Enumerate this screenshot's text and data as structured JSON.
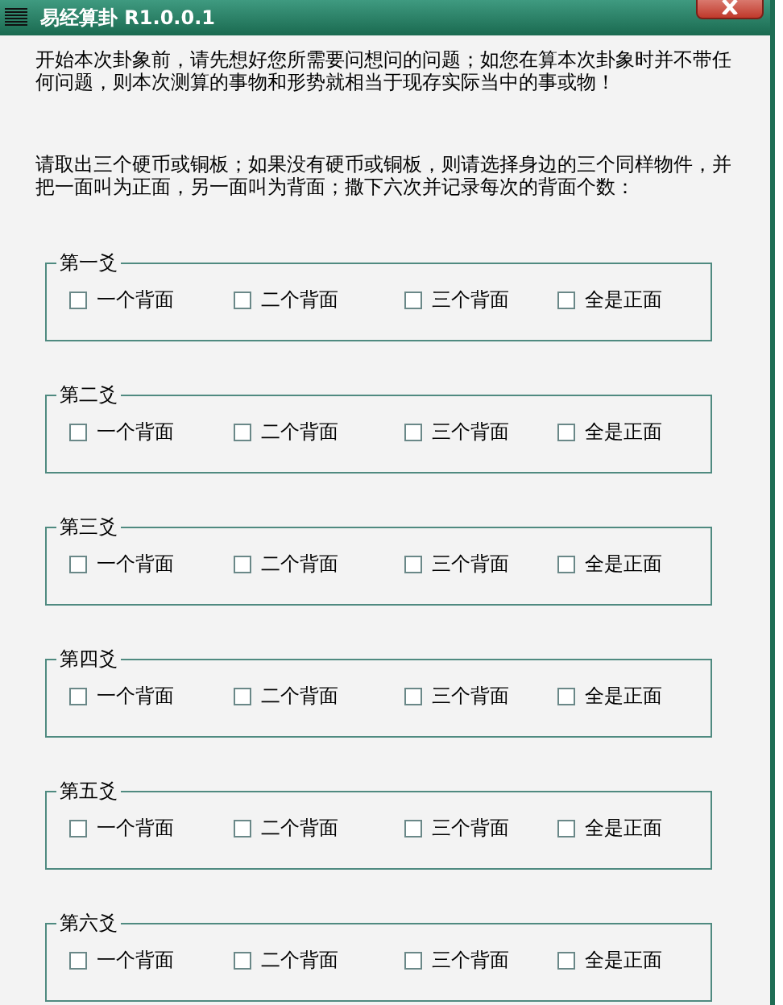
{
  "window": {
    "title": "易经算卦 R1.0.0.1"
  },
  "intro": [
    "开始本次卦象前，请先想好您所需要问想问的问题；如您在算本次卦象时并不带任何问题，则本次测算的事物和形势就相当于现存实际当中的事或物！",
    "请取出三个硬币或铜板；如果没有硬币或铜板，则请选择身边的三个同样物件，并把一面叫为正面，另一面叫为背面；撒下六次并记录每次的背面个数："
  ],
  "groups": [
    {
      "title": "第一爻",
      "options": [
        {
          "label": "一个背面",
          "checked": false
        },
        {
          "label": "二个背面",
          "checked": false
        },
        {
          "label": "三个背面",
          "checked": false
        },
        {
          "label": "全是正面",
          "checked": false
        }
      ]
    },
    {
      "title": "第二爻",
      "options": [
        {
          "label": "一个背面",
          "checked": false
        },
        {
          "label": "二个背面",
          "checked": false
        },
        {
          "label": "三个背面",
          "checked": false
        },
        {
          "label": "全是正面",
          "checked": false
        }
      ]
    },
    {
      "title": "第三爻",
      "options": [
        {
          "label": "一个背面",
          "checked": false
        },
        {
          "label": "二个背面",
          "checked": false
        },
        {
          "label": "三个背面",
          "checked": false
        },
        {
          "label": "全是正面",
          "checked": false
        }
      ]
    },
    {
      "title": "第四爻",
      "options": [
        {
          "label": "一个背面",
          "checked": false
        },
        {
          "label": "二个背面",
          "checked": false
        },
        {
          "label": "三个背面",
          "checked": false
        },
        {
          "label": "全是正面",
          "checked": false
        }
      ]
    },
    {
      "title": "第五爻",
      "options": [
        {
          "label": "一个背面",
          "checked": false
        },
        {
          "label": "二个背面",
          "checked": false
        },
        {
          "label": "三个背面",
          "checked": false
        },
        {
          "label": "全是正面",
          "checked": false
        }
      ]
    },
    {
      "title": "第六爻",
      "options": [
        {
          "label": "一个背面",
          "checked": false
        },
        {
          "label": "二个背面",
          "checked": false
        },
        {
          "label": "三个背面",
          "checked": false
        },
        {
          "label": "全是正面",
          "checked": false
        }
      ]
    }
  ]
}
